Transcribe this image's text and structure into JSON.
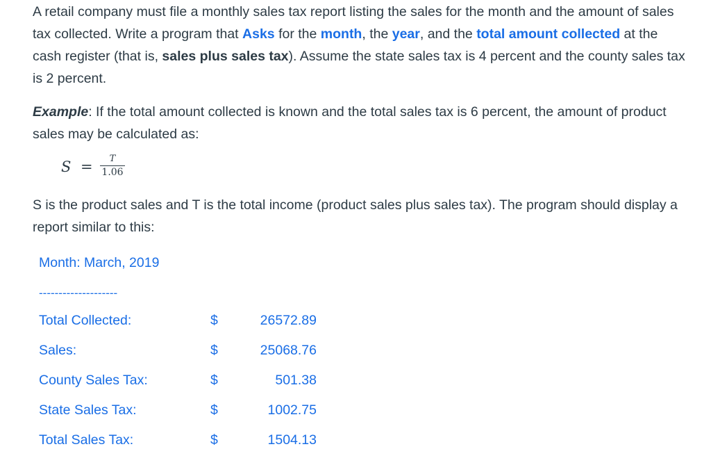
{
  "intro": {
    "t1": "A retail company must file a monthly sales tax report listing the sales for the month and the amount of sales tax collected. Write a program that ",
    "asks": "Asks",
    "t2": " for the ",
    "month": "month",
    "t3": ", the ",
    "year": "year",
    "t4": ", and the ",
    "total_amount_collected": "total amount collected",
    "t5": " at the cash register (that is, ",
    "sales_plus": "sales plus sales tax",
    "t6": "). Assume the state sales tax is 4 percent and the county sales tax is 2 percent."
  },
  "example": {
    "label": "Example",
    "text": ": If the total amount collected is known and the total sales tax is 6 percent, the amount of product sales may be calculated as:"
  },
  "formula": {
    "lhs": "S",
    "eq": "=",
    "numerator": "T",
    "denominator": "1.06"
  },
  "explanation": "S is the product sales and T is the total income (product sales plus sales tax). The program should display a report similar to this:",
  "report": {
    "month_line": "Month: March, 2019",
    "divider": "--------------------",
    "rows": [
      {
        "label": "Total Collected:",
        "currency": "$",
        "amount": "26572.89"
      },
      {
        "label": "Sales:",
        "currency": "$",
        "amount": "25068.76"
      },
      {
        "label": "County Sales Tax:",
        "currency": "$",
        "amount": "501.38"
      },
      {
        "label": "State Sales Tax:",
        "currency": "$",
        "amount": "1002.75"
      },
      {
        "label": "Total Sales Tax:",
        "currency": "$",
        "amount": "1504.13"
      }
    ]
  },
  "colors": {
    "text": "#2d3b45",
    "accent": "#1a6ee6"
  }
}
